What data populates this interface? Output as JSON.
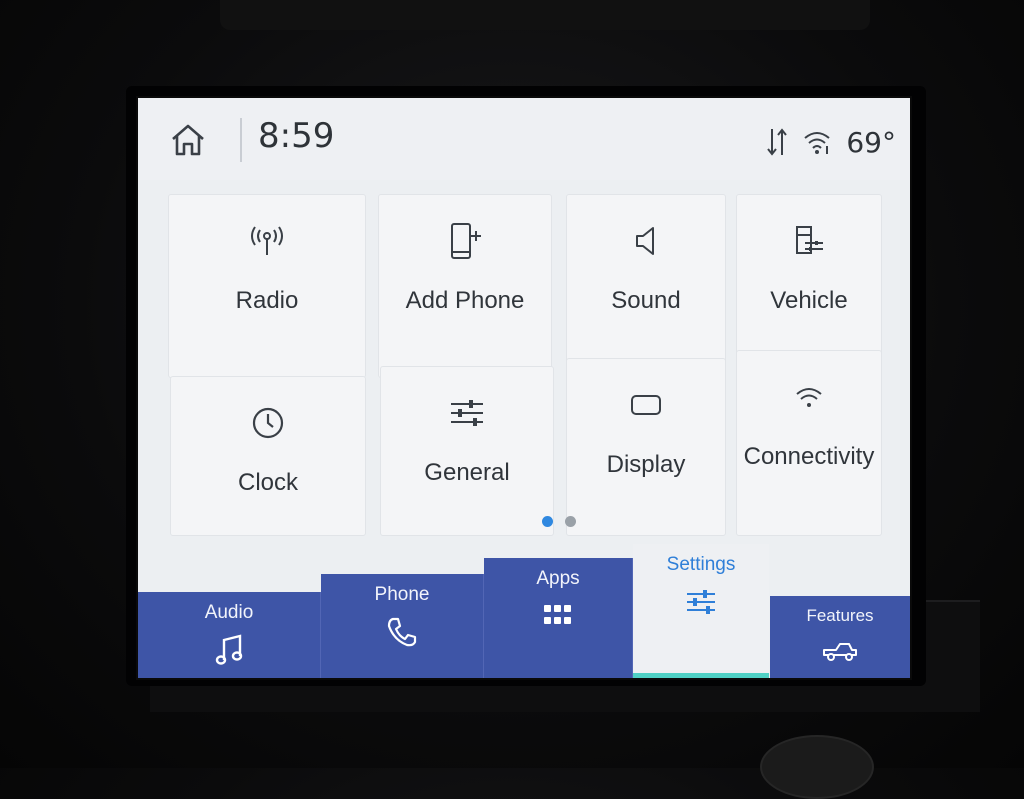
{
  "status_bar": {
    "time": "8:59",
    "temperature": "69°",
    "icons": [
      "home-icon",
      "data-transfer-icon",
      "wifi-icon"
    ]
  },
  "settings_tiles": [
    {
      "label": "Radio",
      "icon": "radio-antenna-icon"
    },
    {
      "label": "Add Phone",
      "icon": "add-phone-icon"
    },
    {
      "label": "Sound",
      "icon": "speaker-icon"
    },
    {
      "label": "Vehicle",
      "icon": "vehicle-settings-icon"
    },
    {
      "label": "Clock",
      "icon": "clock-icon"
    },
    {
      "label": "General",
      "icon": "sliders-icon"
    },
    {
      "label": "Display",
      "icon": "display-icon"
    },
    {
      "label": "Connectivity",
      "icon": "wifi-icon"
    }
  ],
  "pager": {
    "pages": 2,
    "current": 1
  },
  "bottom_nav": [
    {
      "label": "Audio",
      "icon": "music-note-icon"
    },
    {
      "label": "Phone",
      "icon": "phone-icon"
    },
    {
      "label": "Apps",
      "icon": "apps-grid-icon"
    },
    {
      "label": "Settings",
      "icon": "sliders-icon",
      "selected": true
    },
    {
      "label": "Features",
      "icon": "truck-icon"
    }
  ],
  "colors": {
    "nav_background": "#3e55a7",
    "accent_blue": "#2f88e0",
    "selected_underline": "#4fd1c5",
    "screen_background": "#eceff2"
  }
}
